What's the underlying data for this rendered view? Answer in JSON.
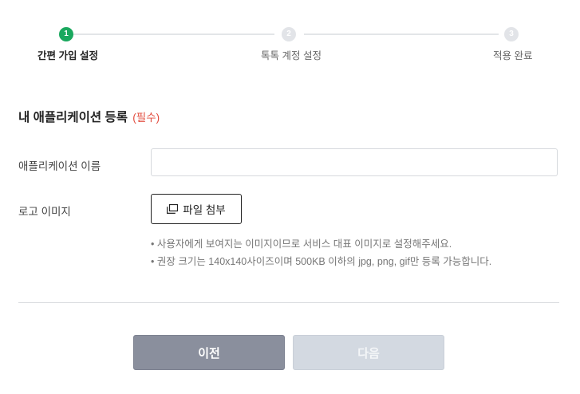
{
  "stepper": {
    "steps": [
      {
        "number": "1",
        "label": "간편 가입 설정",
        "state": "active"
      },
      {
        "number": "2",
        "label": "톡톡 계정 설정",
        "state": "inactive"
      },
      {
        "number": "3",
        "label": "적용 완료",
        "state": "inactive"
      }
    ]
  },
  "section": {
    "title": "내 애플리케이션 등록",
    "required": "(필수)"
  },
  "form": {
    "app_name_label": "애플리케이션 이름",
    "app_name_value": "",
    "logo_label": "로고 이미지",
    "attach_button_label": "파일 첨부",
    "attach_icon": "attach-file-icon",
    "notes": [
      "• 사용자에게 보여지는 이미지이므로 서비스 대표 이미지로 설정해주세요.",
      "• 권장 크기는 140x140사이즈이며 500KB 이하의 jpg, png, gif만 등록 가능합니다."
    ]
  },
  "footer": {
    "prev_label": "이전",
    "next_label": "다음"
  },
  "colors": {
    "active_step": "#1aa85e",
    "inactive_step": "#e2e4e8",
    "required": "#e24c3e",
    "prev_button": "#8a8f9d",
    "next_button_disabled": "#d3d9e1"
  }
}
